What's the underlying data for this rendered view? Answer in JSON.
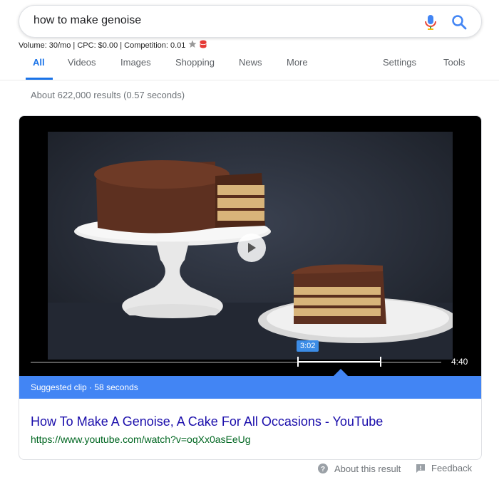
{
  "search": {
    "query": "how to make genoise"
  },
  "keyword_stats": {
    "text": "Volume: 30/mo | CPC: $0.00 | Competition: 0.01"
  },
  "tabs": [
    {
      "label": "All"
    },
    {
      "label": "Videos"
    },
    {
      "label": "Images"
    },
    {
      "label": "Shopping"
    },
    {
      "label": "News"
    },
    {
      "label": "More"
    },
    {
      "label": "Settings"
    },
    {
      "label": "Tools"
    }
  ],
  "results_stats": "About 622,000 results (0.57 seconds)",
  "video": {
    "clip_start": "3:02",
    "duration": "4:40",
    "suggested_clip": "Suggested clip · 58 seconds",
    "title": "How To Make A Genoise, A Cake For All Occasions - YouTube",
    "url": "https://www.youtube.com/watch?v=oqXx0asEeUg"
  },
  "footer": {
    "about": "About this result",
    "feedback": "Feedback"
  },
  "colors": {
    "accent": "#1a73e8",
    "link": "#1a0dab",
    "url": "#006621",
    "banner": "#4285f4"
  }
}
